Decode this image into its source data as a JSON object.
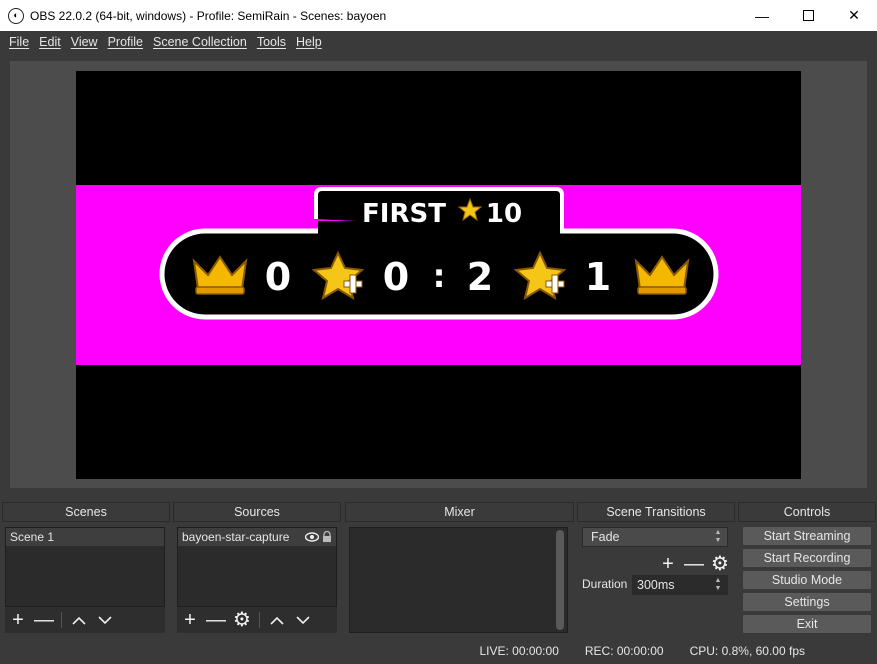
{
  "window": {
    "title": "OBS 22.0.2 (64-bit, windows) - Profile: SemiRain - Scenes: bayoen"
  },
  "menu": [
    "File",
    "Edit",
    "View",
    "Profile",
    "Scene Collection",
    "Tools",
    "Help"
  ],
  "preview": {
    "scoreboard": {
      "header_label": "FIRST",
      "header_target": "10",
      "left_score": "0",
      "left_stars": "0",
      "separator": ":",
      "right_stars": "2",
      "right_score": "1"
    },
    "colors": {
      "band": "#ff00ff",
      "canvas": "#000000"
    }
  },
  "docks": {
    "scenes": {
      "title": "Scenes",
      "items": [
        "Scene 1"
      ]
    },
    "sources": {
      "title": "Sources",
      "items": [
        "bayoen-star-capture"
      ]
    },
    "mixer": {
      "title": "Mixer"
    },
    "transitions": {
      "title": "Scene Transitions",
      "selected": "Fade",
      "duration_label": "Duration",
      "duration_value": "300ms"
    },
    "controls": {
      "title": "Controls",
      "buttons": [
        "Start Streaming",
        "Start Recording",
        "Studio Mode",
        "Settings",
        "Exit"
      ]
    }
  },
  "status": {
    "live": "LIVE: 00:00:00",
    "rec": "REC: 00:00:00",
    "cpu": "CPU: 0.8%, 60.00 fps"
  }
}
